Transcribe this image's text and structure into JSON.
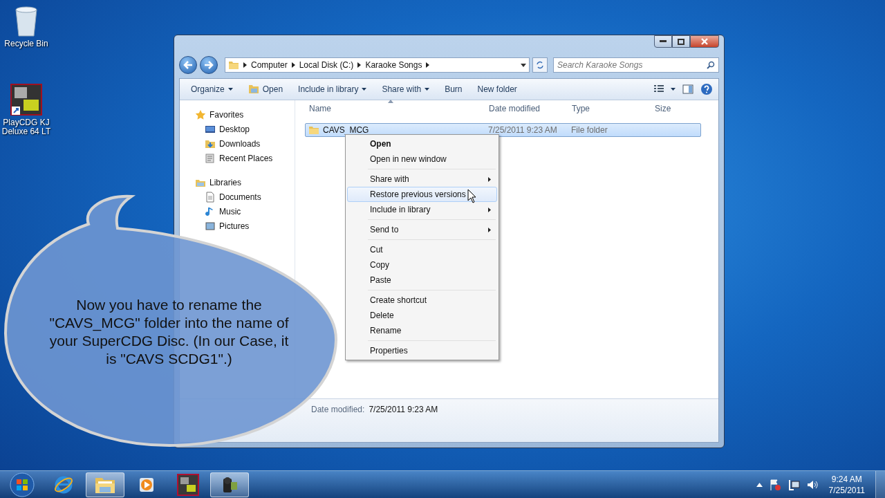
{
  "desktop_icons": [
    {
      "kind": "recycle",
      "label": "Recycle Bin"
    },
    {
      "kind": "kj",
      "label": "PlayCDG KJ Deluxe 64 LT"
    }
  ],
  "window": {
    "address": [
      "Computer",
      "Local Disk (C:)",
      "Karaoke Songs"
    ],
    "search": {
      "placeholder": "Search Karaoke Songs"
    },
    "toolbar": [
      {
        "kind": "dropdown",
        "label": "Organize"
      },
      {
        "kind": "open",
        "label": "Open"
      },
      {
        "kind": "dropdown",
        "label": "Include in library"
      },
      {
        "kind": "dropdown",
        "label": "Share with"
      },
      {
        "kind": "plain",
        "label": "Burn"
      },
      {
        "kind": "plain",
        "label": "New folder"
      }
    ],
    "nav": [
      {
        "kind": "star",
        "label": "Favorites",
        "children": [
          {
            "kind": "desktop",
            "label": "Desktop"
          },
          {
            "kind": "downloads",
            "label": "Downloads"
          },
          {
            "kind": "recent",
            "label": "Recent Places"
          }
        ]
      },
      {
        "kind": "library",
        "label": "Libraries",
        "children": [
          {
            "kind": "document",
            "label": "Documents"
          },
          {
            "kind": "music",
            "label": "Music"
          },
          {
            "kind": "pictures",
            "label": "Pictures"
          }
        ]
      }
    ],
    "columns": [
      "Name",
      "Date modified",
      "Type",
      "Size"
    ],
    "rows": [
      {
        "name": "CAVS_MCG",
        "date": "7/25/2011 9:23 AM",
        "type": "File folder",
        "selected": true
      }
    ],
    "details": {
      "label": "Date modified:",
      "value": "7/25/2011 9:23 AM"
    }
  },
  "context_menu": [
    {
      "kind": "item",
      "label": "Open",
      "default": true,
      "submenu": false,
      "selected": false
    },
    {
      "kind": "item",
      "label": "Open in new window",
      "default": false,
      "submenu": false,
      "selected": false
    },
    {
      "kind": "separator"
    },
    {
      "kind": "item",
      "label": "Share with",
      "default": false,
      "submenu": true,
      "selected": false
    },
    {
      "kind": "item",
      "label": "Restore previous versions",
      "default": false,
      "submenu": false,
      "selected": true
    },
    {
      "kind": "item",
      "label": "Include in library",
      "default": false,
      "submenu": true,
      "selected": false
    },
    {
      "kind": "separator"
    },
    {
      "kind": "item",
      "label": "Send to",
      "default": false,
      "submenu": true,
      "selected": false
    },
    {
      "kind": "separator"
    },
    {
      "kind": "item",
      "label": "Cut",
      "default": false,
      "submenu": false,
      "selected": false
    },
    {
      "kind": "item",
      "label": "Copy",
      "default": false,
      "submenu": false,
      "selected": false
    },
    {
      "kind": "item",
      "label": "Paste",
      "default": false,
      "submenu": false,
      "selected": false
    },
    {
      "kind": "separator"
    },
    {
      "kind": "item",
      "label": "Create shortcut",
      "default": false,
      "submenu": false,
      "selected": false
    },
    {
      "kind": "item",
      "label": "Delete",
      "default": false,
      "submenu": false,
      "selected": false
    },
    {
      "kind": "item",
      "label": "Rename",
      "default": false,
      "submenu": false,
      "selected": false
    },
    {
      "kind": "separator"
    },
    {
      "kind": "item",
      "label": "Properties",
      "default": false,
      "submenu": false,
      "selected": false
    }
  ],
  "callout": {
    "text": "Now you have to rename the \"CAVS_MCG\" folder into the name of your SuperCDG Disc. (In our Case, it is \"CAVS SCDG1\".)"
  },
  "taskbar": {
    "items": [
      {
        "kind": "start",
        "running": false
      },
      {
        "kind": "browser",
        "running": false
      },
      {
        "kind": "folder",
        "running": true
      },
      {
        "kind": "media",
        "running": false
      },
      {
        "kind": "kj",
        "running": false
      },
      {
        "kind": "camera",
        "running": true
      }
    ],
    "time": "9:24 AM",
    "date": "7/25/2011"
  }
}
